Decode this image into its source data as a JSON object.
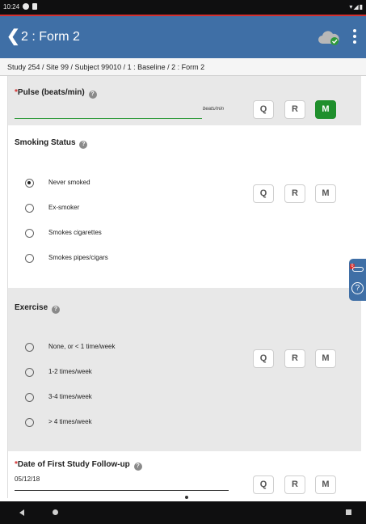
{
  "status_bar": {
    "time": "10:24",
    "right_icons": "▾◢▮"
  },
  "app_bar": {
    "back_glyph": "❮",
    "title": "2 : Form 2",
    "menu_icon": "more-vert-icon",
    "sync_icon": "cloud-check-icon"
  },
  "breadcrumb": "Study 254 / Site 99 / Subject 99010 / 1 : Baseline / 2 : Form 2",
  "colors": {
    "app_bar": "#3f6fa6",
    "required": "#d32f2f",
    "active_button": "#1f8f2c",
    "input_underline_active": "#2e9a3a"
  },
  "buttons": {
    "q": "Q",
    "r": "R",
    "m": "M"
  },
  "fields": {
    "pulse": {
      "required_mark": "*",
      "label": "Pulse (beats/min)",
      "help": "?",
      "unit": "beats/min",
      "value": "",
      "active_button": "M"
    },
    "smoking": {
      "label": "Smoking Status",
      "help": "?",
      "options": [
        "Never smoked",
        "Ex-smoker",
        "Smokes cigarettes",
        "Smokes pipes/cigars"
      ],
      "selected": "Never smoked"
    },
    "exercise": {
      "label": "Exercise",
      "help": "?",
      "options": [
        "None, or < 1 time/week",
        "1-2 times/week",
        "3-4 times/week",
        "> 4 times/week"
      ],
      "selected": ""
    },
    "followup": {
      "required_mark": "*",
      "label": "Date of First Study Follow-up",
      "help": "?",
      "value": "05/12/18"
    }
  },
  "side_tab": {
    "badge": "0",
    "help_glyph": "?"
  }
}
